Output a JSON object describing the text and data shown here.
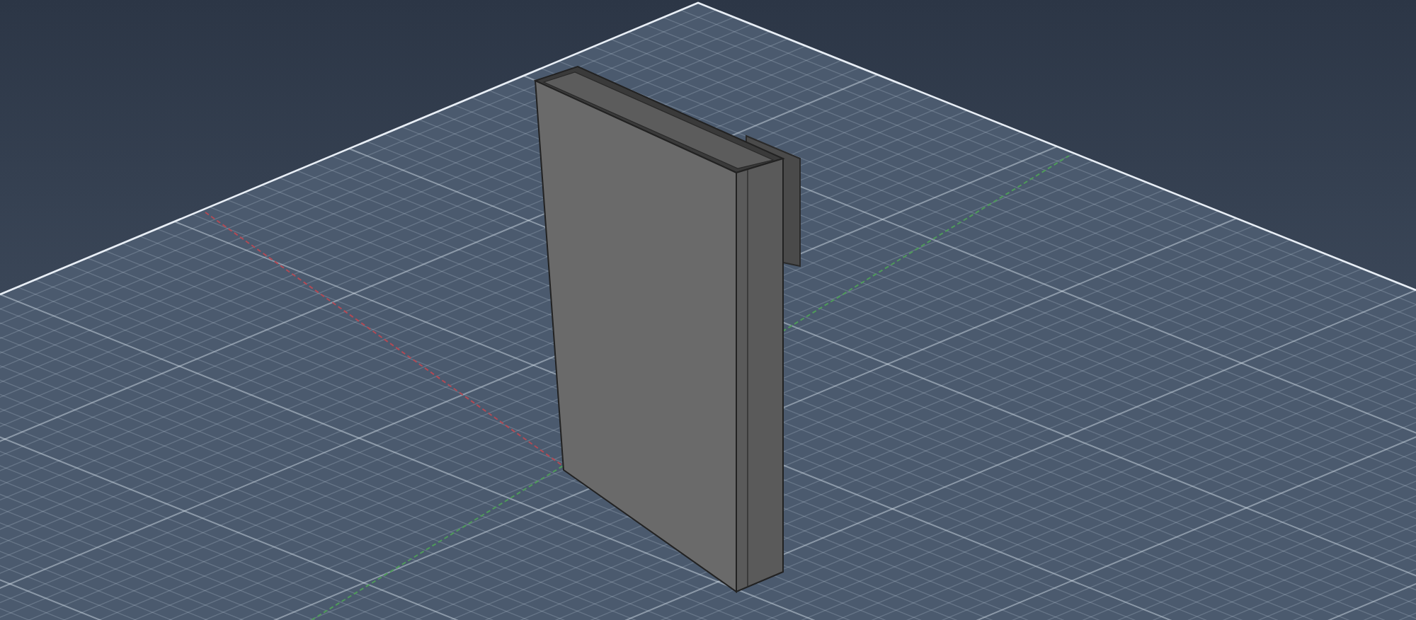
{
  "viewport": {
    "grid_visible": true,
    "axes_visible": true,
    "model_visible": true
  }
}
